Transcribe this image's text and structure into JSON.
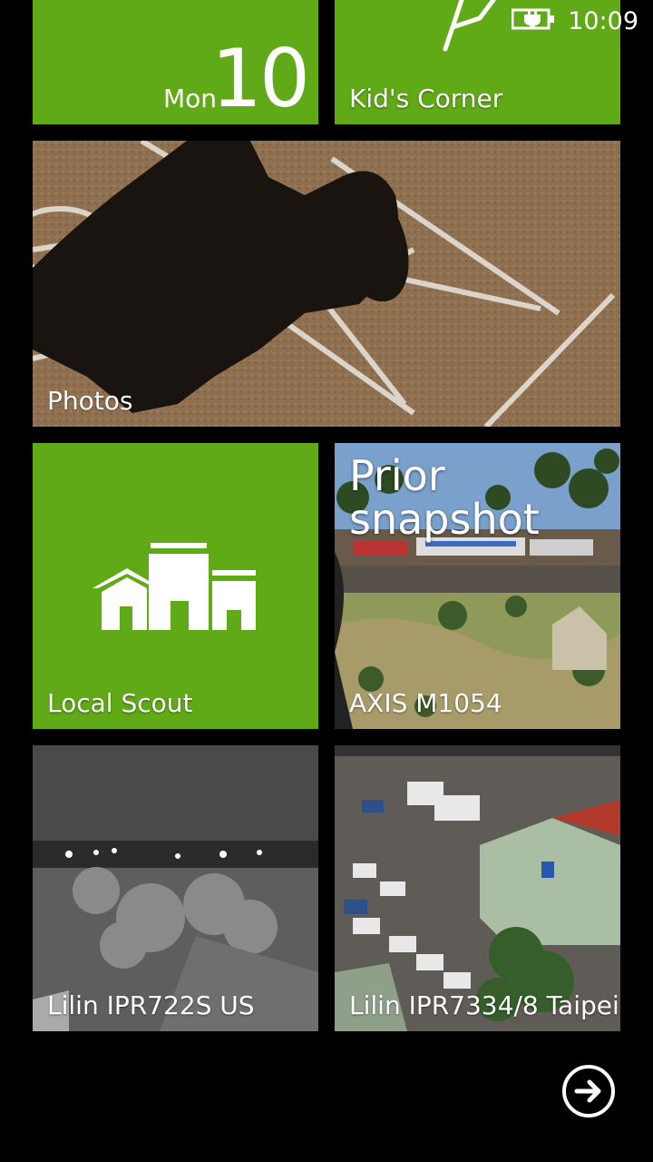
{
  "status_bar": {
    "time": "10:09",
    "battery_icon": "battery-charging-icon"
  },
  "tiles": {
    "calendar": {
      "day": "Mon",
      "date": "10"
    },
    "kids_corner": {
      "label": "Kid's Corner"
    },
    "photos": {
      "label": "Photos"
    },
    "local_scout": {
      "label": "Local Scout",
      "icon": "local-scout-buildings-icon"
    },
    "axis": {
      "caption": "Prior\nsnapshot",
      "label": "AXIS M1054"
    },
    "lilin_us": {
      "label": "Lilin IPR722S US"
    },
    "lilin_taipei": {
      "label": "Lilin IPR7334/8  Taipei"
    }
  },
  "nav": {
    "more_icon": "arrow-right-circle-icon"
  },
  "colors": {
    "accent": "#60a917",
    "background": "#000000"
  }
}
